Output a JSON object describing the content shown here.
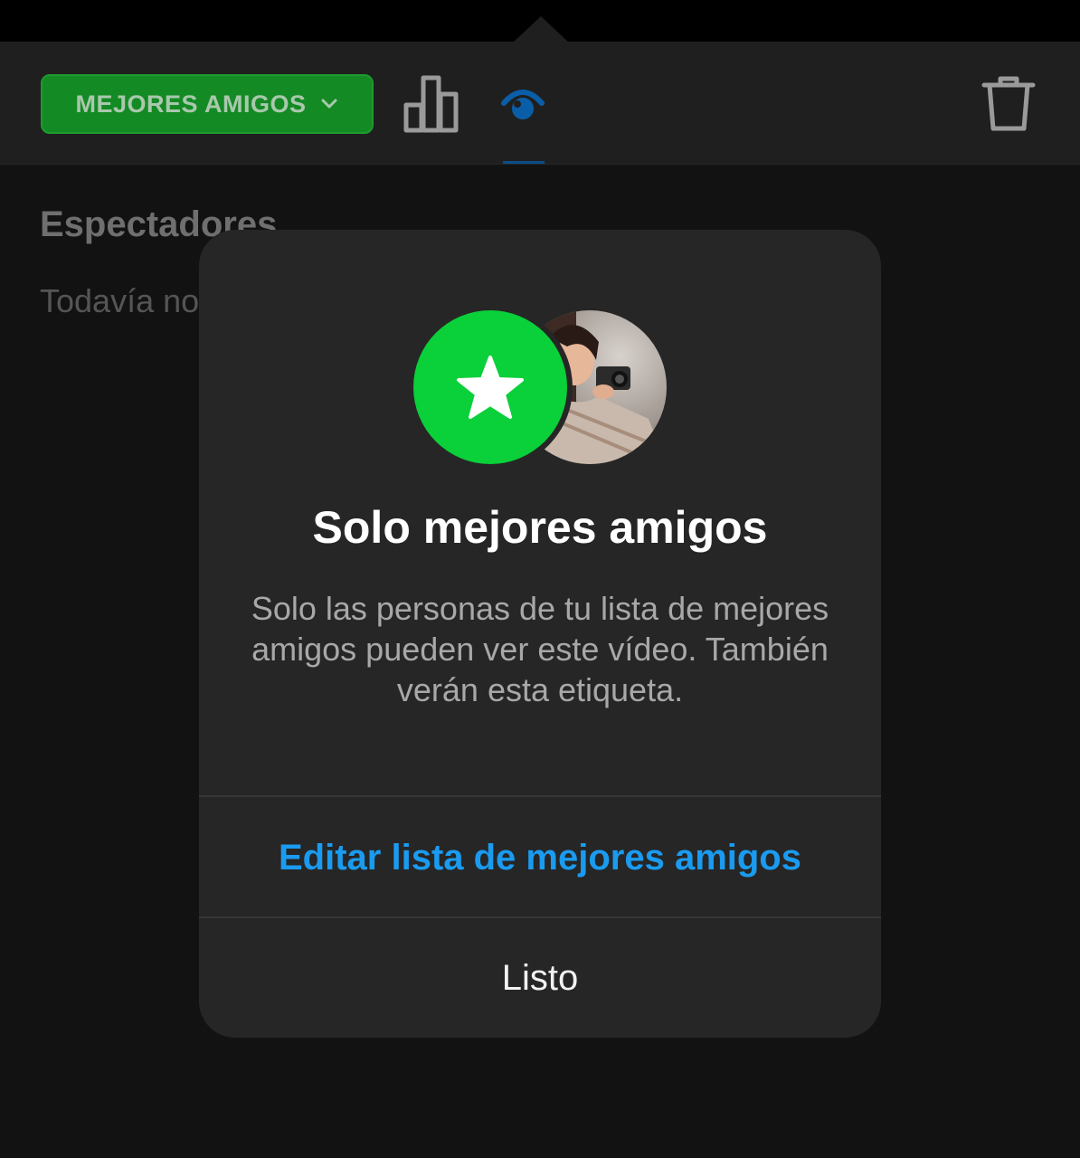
{
  "toolbar": {
    "audience_label": "MEJORES AMIGOS",
    "audience_icon": "chevron-down-icon",
    "stats_icon": "bar-chart-icon",
    "viewers_icon": "eye-icon",
    "delete_icon": "trash-icon",
    "brand_green": "#148a24",
    "active_tab_color": "#0a5ea8"
  },
  "viewers": {
    "title": "Espectadores",
    "empty_text": "Todavía no"
  },
  "modal": {
    "badge_icon": "star-icon",
    "badge_color": "#0ad039",
    "avatar": "profile-photo",
    "title": "Solo mejores amigos",
    "body": "Solo las personas de tu lista de mejores amigos pueden ver este vídeo. También verán esta etiqueta.",
    "edit_action": "Editar lista de mejores amigos",
    "edit_action_color": "#1a9bf0",
    "done_action": "Listo"
  }
}
